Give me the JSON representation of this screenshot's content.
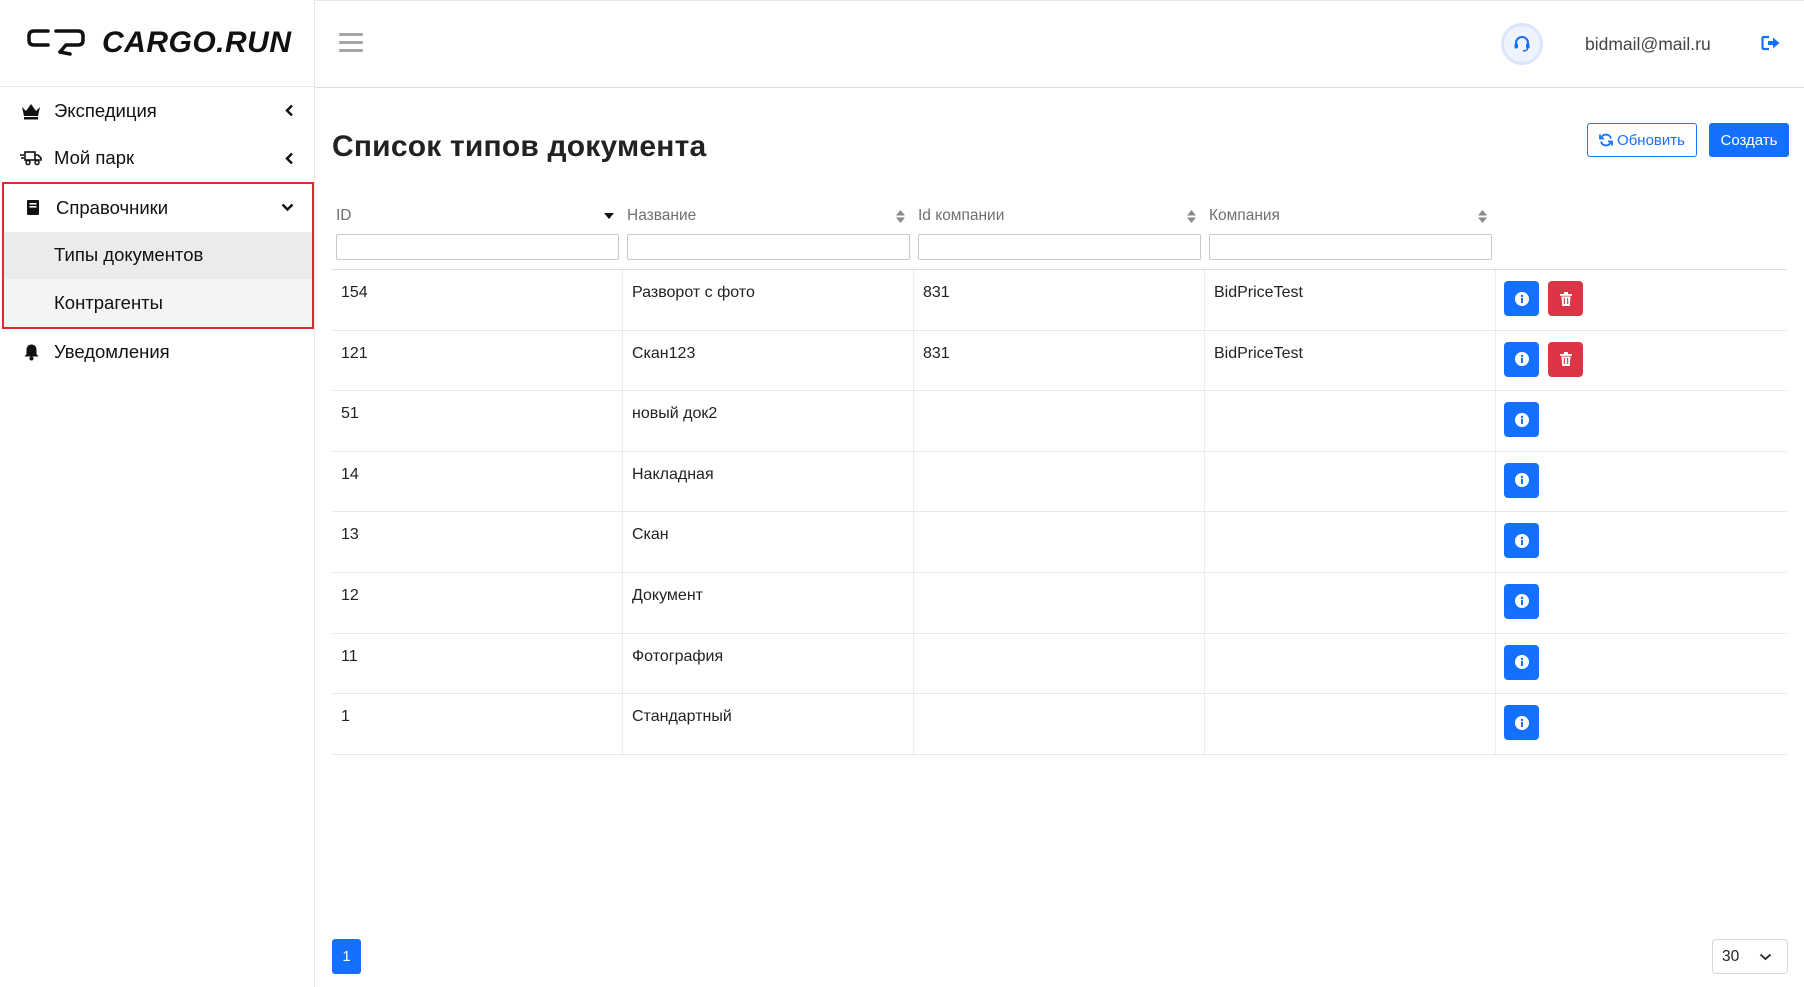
{
  "brand": {
    "name": "CARGO.RUN"
  },
  "sidebar": {
    "items": [
      {
        "label": "Экспедиция",
        "icon": "crown-icon"
      },
      {
        "label": "Мой парк",
        "icon": "truck-icon"
      },
      {
        "label": "Справочники",
        "icon": "book-icon"
      },
      {
        "label": "Уведомления",
        "icon": "bell-icon"
      }
    ],
    "subitems": [
      {
        "label": "Типы документов",
        "active": true
      },
      {
        "label": "Контрагенты",
        "active": false
      }
    ]
  },
  "header": {
    "user_email": "bidmail@mail.ru"
  },
  "page": {
    "title": "Список типов документа",
    "refresh_label": "Обновить",
    "create_label": "Создать"
  },
  "table": {
    "columns": [
      "ID",
      "Название",
      "Id компании",
      "Компания"
    ],
    "rows": [
      {
        "id": "154",
        "name": "Разворот с фото",
        "company_id": "831",
        "company": "BidPriceTest",
        "deletable": true
      },
      {
        "id": "121",
        "name": "Скан123",
        "company_id": "831",
        "company": "BidPriceTest",
        "deletable": true
      },
      {
        "id": "51",
        "name": "новый док2",
        "company_id": "",
        "company": "",
        "deletable": false
      },
      {
        "id": "14",
        "name": "Накладная",
        "company_id": "",
        "company": "",
        "deletable": false
      },
      {
        "id": "13",
        "name": "Скан",
        "company_id": "",
        "company": "",
        "deletable": false
      },
      {
        "id": "12",
        "name": "Документ",
        "company_id": "",
        "company": "",
        "deletable": false
      },
      {
        "id": "11",
        "name": "Фотография",
        "company_id": "",
        "company": "",
        "deletable": false
      },
      {
        "id": "1",
        "name": "Стандартный",
        "company_id": "",
        "company": "",
        "deletable": false
      }
    ]
  },
  "pagination": {
    "current_page": "1",
    "page_size": "30"
  },
  "colors": {
    "primary": "#1470ff",
    "danger": "#dc3545",
    "highlight_border": "#dc2a2f"
  }
}
